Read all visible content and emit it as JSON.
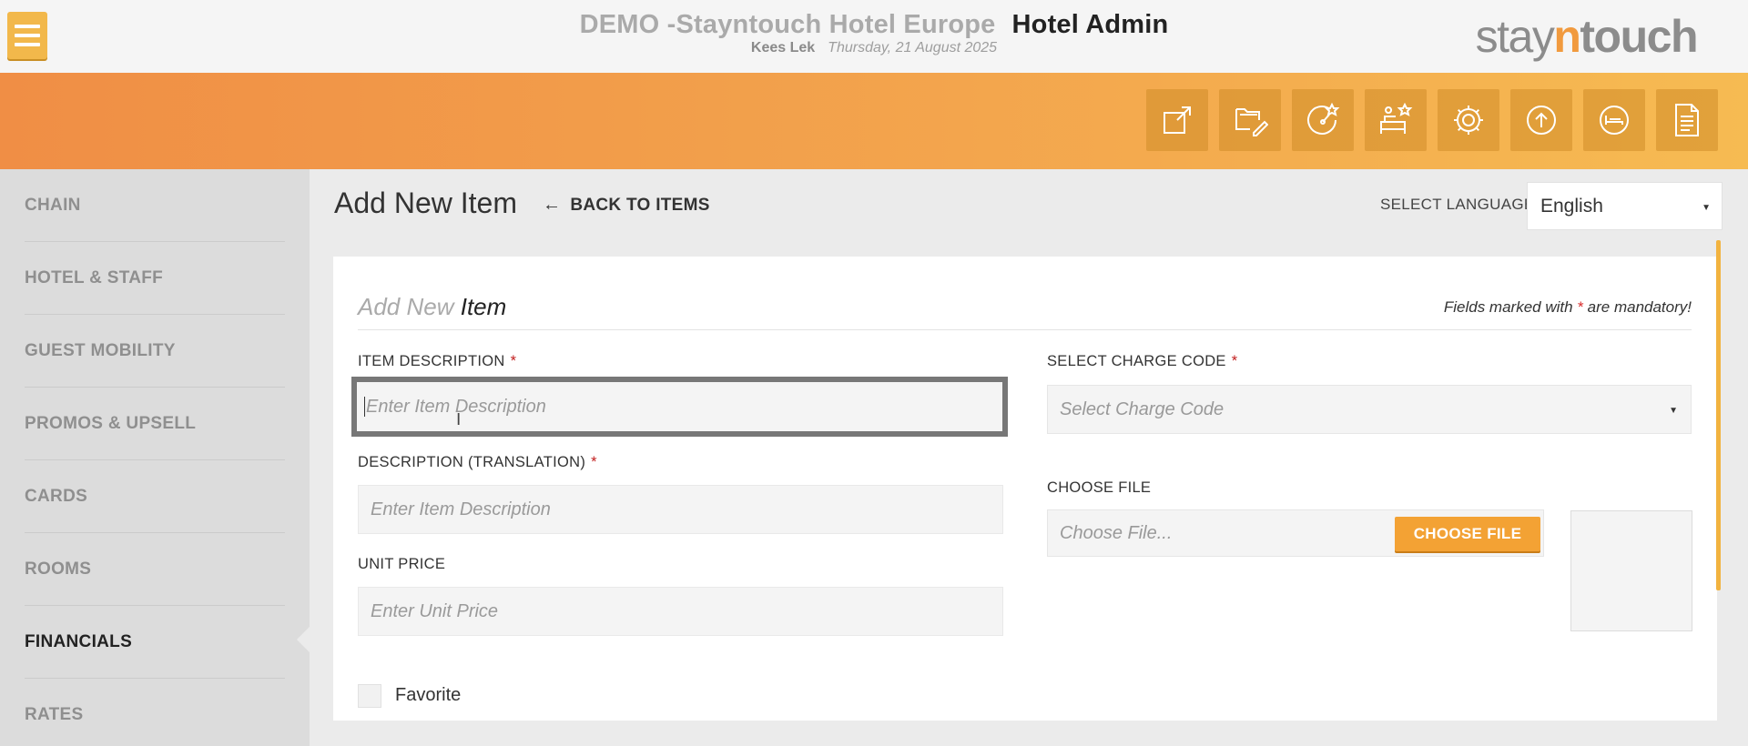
{
  "header": {
    "hotel_name": "DEMO -Stayntouch Hotel Europe",
    "app_name": "Hotel Admin",
    "user_name": "Kees Lek",
    "date": "Thursday, 21 August 2025",
    "logo": {
      "part1": "stay",
      "part2": "n",
      "part3": "touch"
    },
    "menu_icon": "hamburger-menu-icon"
  },
  "colors": {
    "band_start": "#f08e45",
    "band_end": "#f6bb52",
    "accent": "#f3a234",
    "required_star": "#c21f1f",
    "focus_border": "#777777"
  },
  "toolbar": {
    "buttons": [
      {
        "icon": "external-link-icon"
      },
      {
        "icon": "folder-edit-icon"
      },
      {
        "icon": "dashboard-star-icon"
      },
      {
        "icon": "sofa-star-icon"
      },
      {
        "icon": "settings-gear-icon"
      },
      {
        "icon": "upload-circle-icon"
      },
      {
        "icon": "bed-circle-icon"
      },
      {
        "icon": "document-icon"
      }
    ]
  },
  "sidebar": {
    "items": [
      {
        "label": "CHAIN",
        "active": false
      },
      {
        "label": "HOTEL & STAFF",
        "active": false
      },
      {
        "label": "GUEST MOBILITY",
        "active": false
      },
      {
        "label": "PROMOS & UPSELL",
        "active": false
      },
      {
        "label": "CARDS",
        "active": false
      },
      {
        "label": "ROOMS",
        "active": false
      },
      {
        "label": "FINANCIALS",
        "active": true
      },
      {
        "label": "RATES",
        "active": false
      }
    ]
  },
  "page": {
    "title": "Add New Item",
    "back_label": "BACK TO ITEMS",
    "back_icon": "arrow-left-icon",
    "language_label": "SELECT LANGUAGE",
    "language_value": "English"
  },
  "form": {
    "title_prefix": "Add New",
    "title_strong": "Item",
    "mandatory_before": "Fields marked with",
    "mandatory_star": "*",
    "mandatory_after": "are mandatory!",
    "item_description": {
      "label": "ITEM DESCRIPTION",
      "required": "*",
      "value": "",
      "placeholder": "Enter Item Description"
    },
    "description_translation": {
      "label": "DESCRIPTION (TRANSLATION)",
      "required": "*",
      "value": "",
      "placeholder": "Enter Item Description"
    },
    "unit_price": {
      "label": "UNIT PRICE",
      "value": "",
      "placeholder": "Enter Unit Price"
    },
    "charge_code": {
      "label": "SELECT CHARGE CODE",
      "required": "*",
      "placeholder": "Select Charge Code"
    },
    "choose_file": {
      "label": "CHOOSE FILE",
      "placeholder": "Choose File...",
      "button": "CHOOSE FILE"
    },
    "favorite": {
      "label": "Favorite",
      "checked": false
    }
  }
}
